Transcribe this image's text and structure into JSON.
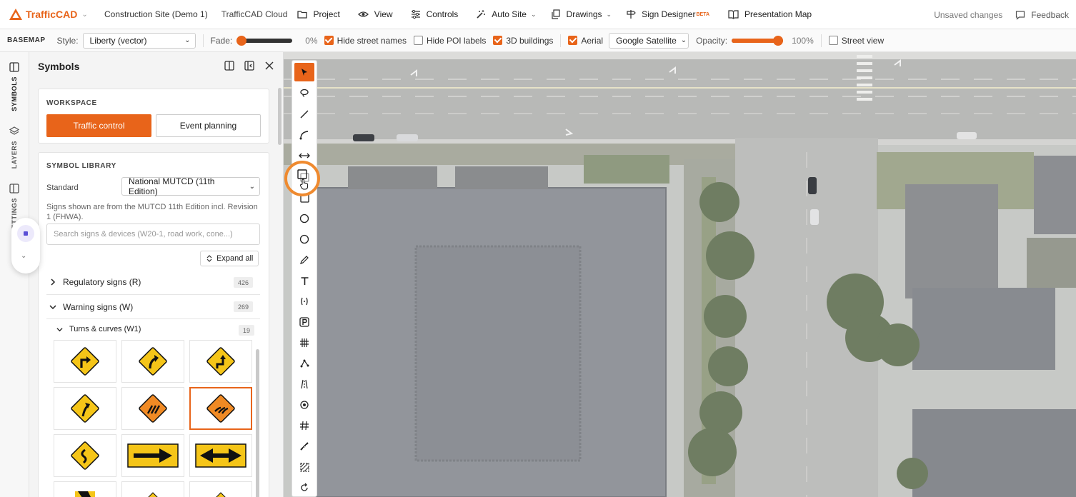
{
  "brand": {
    "name": "TrafficCAD",
    "accent": "#e8641a"
  },
  "topnav": {
    "project_name": "Construction Site (Demo 1)",
    "cloud": "TrafficCAD Cloud",
    "items": [
      {
        "label": "Project",
        "icon": "folder-icon"
      },
      {
        "label": "View",
        "icon": "eye-icon"
      },
      {
        "label": "Controls",
        "icon": "sliders-icon"
      },
      {
        "label": "Auto Site",
        "icon": "magic-wand-icon"
      },
      {
        "label": "Drawings",
        "icon": "copy-icon"
      },
      {
        "label": "Sign Designer",
        "badge": "BETA",
        "icon": "signpost-icon"
      },
      {
        "label": "Presentation Map",
        "icon": "book-icon"
      }
    ],
    "status": "Unsaved changes",
    "feedback": "Feedback"
  },
  "basemap": {
    "label": "BASEMAP",
    "style_label": "Style:",
    "style_value": "Liberty (vector)",
    "fade_label": "Fade:",
    "fade_value": "0%",
    "fade_fraction": 0,
    "hide_street_names": {
      "label": "Hide street names",
      "checked": true
    },
    "hide_poi_labels": {
      "label": "Hide POI labels",
      "checked": false
    },
    "buildings_3d": {
      "label": "3D buildings",
      "checked": true
    },
    "aerial": {
      "label": "Aerial",
      "checked": true
    },
    "aerial_source": "Google Satellite",
    "opacity_label": "Opacity:",
    "opacity_value": "100%",
    "opacity_fraction": 1,
    "street_view": {
      "label": "Street view",
      "checked": false
    }
  },
  "rail": {
    "tabs": [
      "SYMBOLS",
      "LAYERS",
      "SETTINGS"
    ]
  },
  "panel": {
    "title": "Symbols",
    "workspace": {
      "label": "WORKSPACE",
      "active": "Traffic control",
      "other": "Event planning"
    },
    "library": {
      "label": "SYMBOL LIBRARY",
      "standard_label": "Standard",
      "standard_value": "National MUTCD (11th Edition)",
      "note": "Signs shown are from the MUTCD 11th Edition incl. Revision 1 (FHWA).",
      "search_placeholder": "Search signs & devices (W20-1, road work, cone...)",
      "expand_all": "Expand all",
      "groups": [
        {
          "label": "Regulatory signs (R)",
          "count": "426",
          "expanded": false
        },
        {
          "label": "Warning signs (W)",
          "count": "269",
          "expanded": true
        }
      ],
      "subgroup": {
        "label": "Turns & curves (W1)",
        "count": "19"
      }
    }
  }
}
